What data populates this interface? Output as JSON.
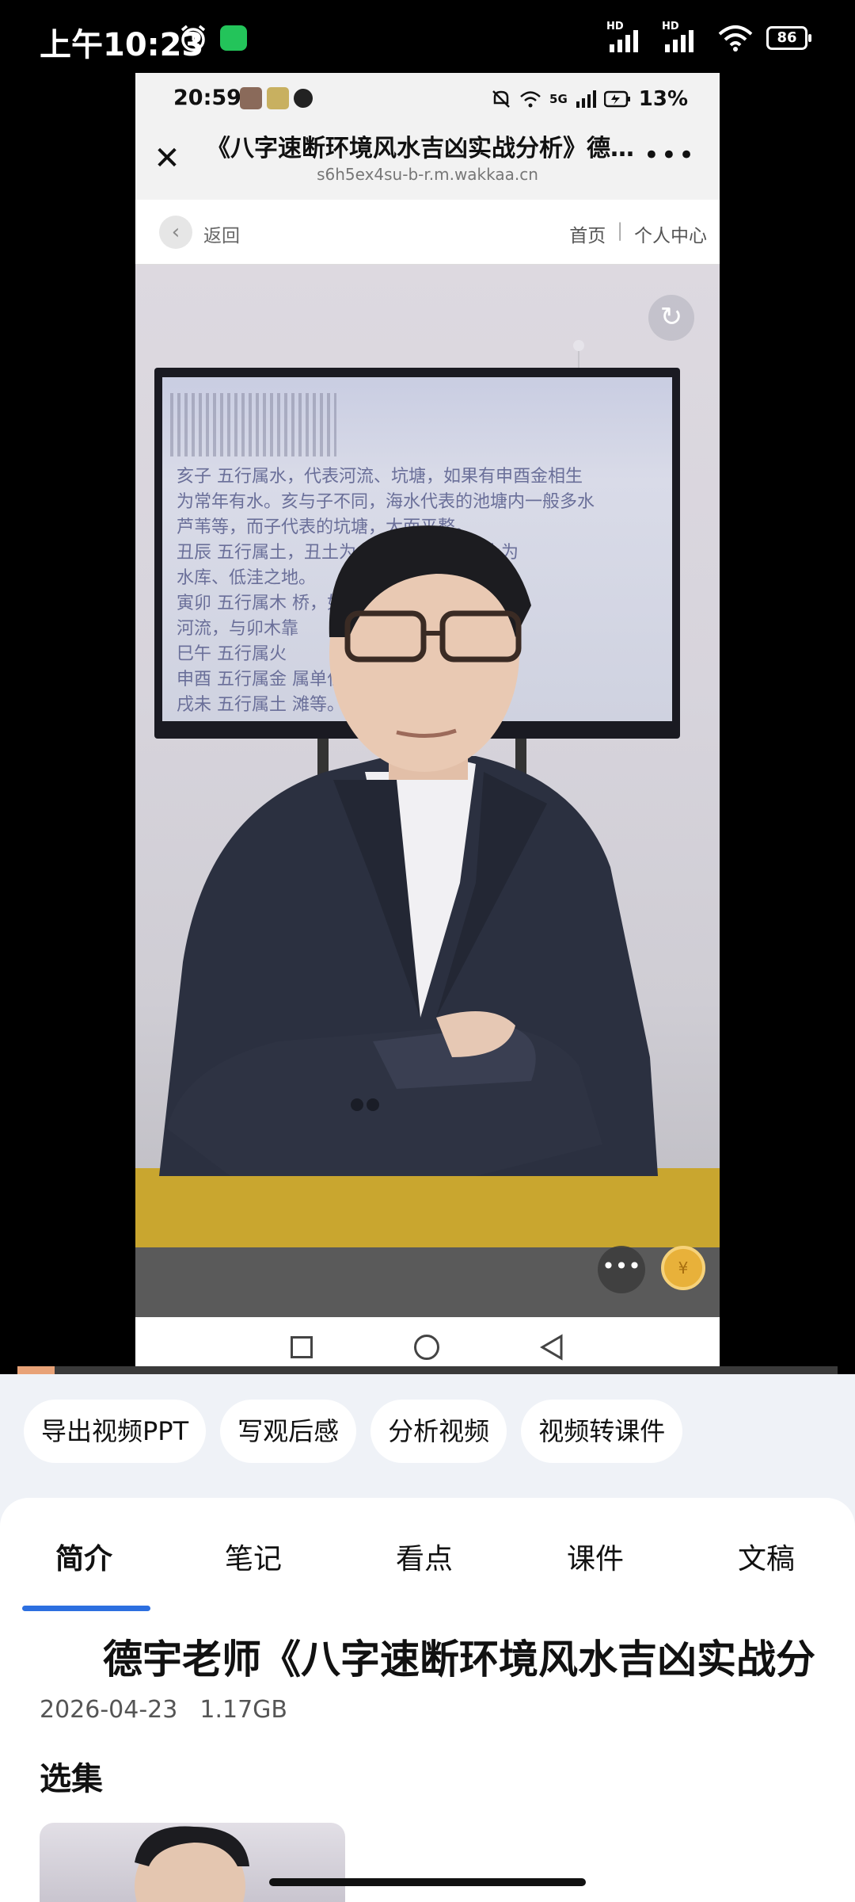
{
  "os_status": {
    "time": "上午10:23",
    "signal1_label": "HD",
    "signal2_label": "HD",
    "battery": "86"
  },
  "inner_phone": {
    "status_time": "20:59",
    "battery_pct": "13%",
    "network": "5G",
    "page_title": "《八字速断环境风水吉凶实战分析》德...",
    "url": "s6h5ex4su-b-r.m.wakkaa.cn",
    "back_label": "返回",
    "link_home": "首页",
    "link_separator": "|",
    "link_profile": "个人中心",
    "slide_lines": [
      "亥子  五行属水，代表河流、坑塘，如果有申酉金相生",
      "为常年有水。亥与子不同，海水代表的池塘内一般多水",
      "芦苇等，而子代表的坑塘，大而平整。",
      "丑辰  五行属土，丑土为         水坑或水沟，辰土为",
      "水库、低洼之地。",
      "寅卯  五行属木                  桥，如子水主",
      "河流，与卯木靠                  ",
      "巳午  五行属火",
      "申酉  五行属金                  属单位等。",
      "戌未  五行属土                  滩等。"
    ],
    "coin_label": "¥"
  },
  "progress": 0.045,
  "actions": [
    "导出视频PPT",
    "写观后感",
    "分析视频",
    "视频转课件"
  ],
  "tabs": [
    "简介",
    "笔记",
    "看点",
    "课件",
    "文稿"
  ],
  "active_tab": "简介",
  "video": {
    "title": "德宇老师《八字速断环境风水吉凶实战分析》",
    "date": "2026-04-23",
    "size": "1.17GB"
  },
  "section_label": "选集",
  "colors": {
    "accent": "#2c6fe0",
    "wechat": "#23c45a",
    "progress": "#e8a277"
  }
}
